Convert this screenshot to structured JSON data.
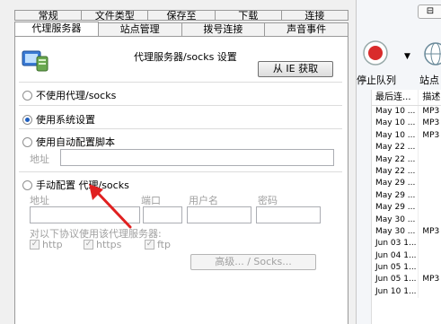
{
  "dialog": {
    "tabs_row1": [
      "常规",
      "文件类型",
      "保存至",
      "下载",
      "连接"
    ],
    "tabs_row2": [
      "代理服务器",
      "站点管理",
      "拨号连接",
      "声音事件"
    ],
    "section_title": "代理服务器/socks 设置",
    "ie_button": "从 IE 获取",
    "opt_none": "不使用代理/socks",
    "opt_system": "使用系统设置",
    "opt_script": "使用自动配置脚本",
    "address_label": "地址",
    "opt_manual": "手动配置 代理/socks",
    "col_address": "地址",
    "col_port": "端口",
    "col_user": "用户名",
    "col_pass": "密码",
    "protocols_label": "对以下协议使用该代理服务器:",
    "proto_http": "http",
    "proto_https": "https",
    "proto_ftp": "ftp",
    "advanced_button": "高级... / Socks...",
    "selected_option": "使用系统设置"
  },
  "app": {
    "top_button": "⊟",
    "stop_label": "停止队列",
    "station_label": "站点",
    "columns": [
      "最后连...",
      "描述"
    ],
    "rows": [
      [
        "May 10 ...",
        "MP3"
      ],
      [
        "May 10 ...",
        "MP3"
      ],
      [
        "May 10 ...",
        "MP3"
      ],
      [
        "May 22 ...",
        ""
      ],
      [
        "May 22 ...",
        ""
      ],
      [
        "May 22 ...",
        ""
      ],
      [
        "May 29 ...",
        ""
      ],
      [
        "May 29 ...",
        ""
      ],
      [
        "May 29 ...",
        ""
      ],
      [
        "May 30 ...",
        ""
      ],
      [
        "May 30 ...",
        "MP3"
      ],
      [
        "Jun 03 1...",
        ""
      ],
      [
        "Jun 04 1...",
        ""
      ],
      [
        "Jun 05 1...",
        ""
      ],
      [
        "Jun 05 1...",
        "MP3"
      ],
      [
        "Jun 10 1...",
        ""
      ]
    ]
  },
  "colors": {
    "accent": "#1f5fbf",
    "arrow": "#e02020",
    "stop_red": "#d92b2b"
  }
}
